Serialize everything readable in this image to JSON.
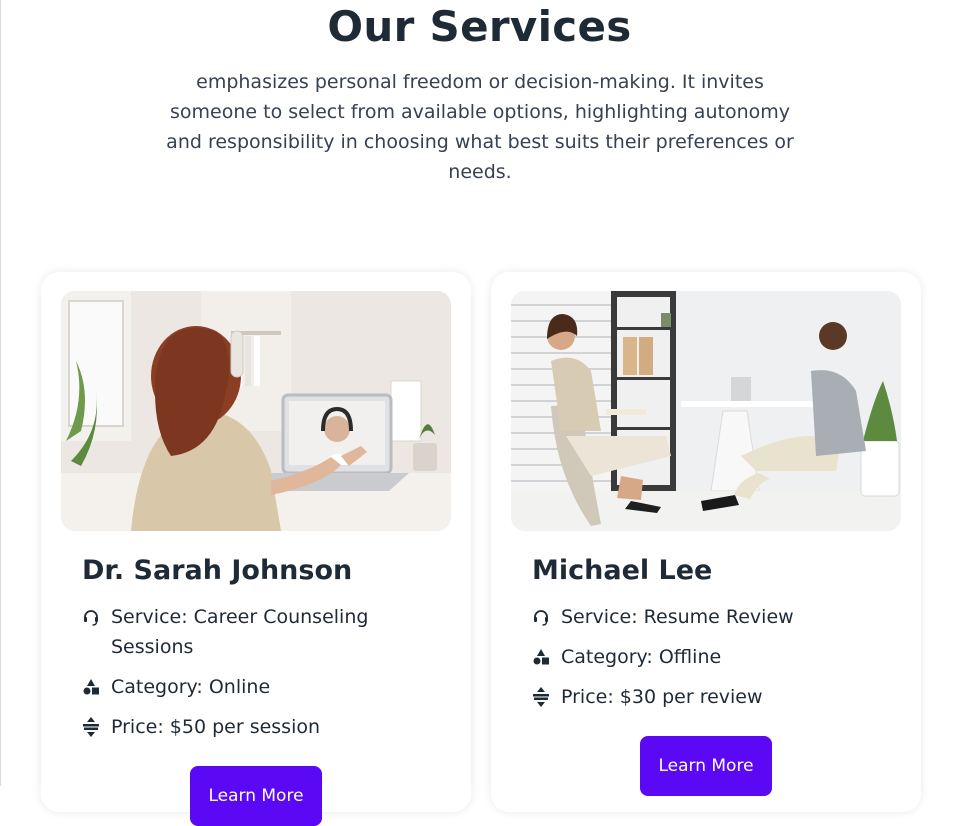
{
  "section": {
    "title": "Our Services",
    "description": "emphasizes personal freedom or decision-making. It invites someone to select from available options, highlighting autonomy and responsibility in choosing what best suits their preferences or needs."
  },
  "cards": [
    {
      "name": "Dr. Sarah Johnson",
      "service": "Service: Career Counseling Sessions",
      "category": "Category: Online",
      "price": "Price: $50 per session",
      "button": "Learn More",
      "photo_icon": "video-call-photo"
    },
    {
      "name": "Michael Lee",
      "service": "Service: Resume Review",
      "category": "Category: Offline",
      "price": "Price: $30 per review",
      "button": "Learn More",
      "photo_icon": "office-meeting-photo"
    }
  ],
  "icons": {
    "service": "headset-icon",
    "category": "shapes-icon",
    "price": "leader-price-icon"
  },
  "colors": {
    "accent": "#5b08f5",
    "heading": "#1f2a37",
    "text": "#374151"
  }
}
